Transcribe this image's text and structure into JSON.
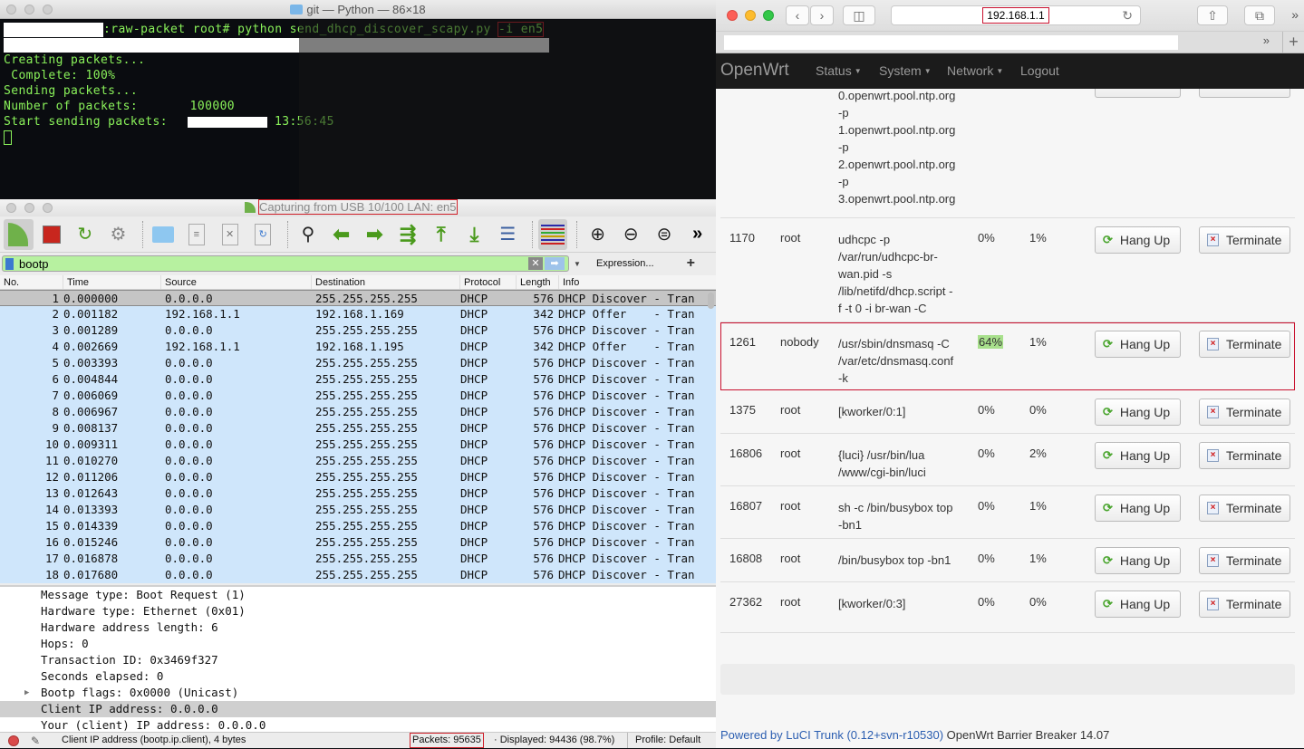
{
  "terminal": {
    "title": "git — Python — 86×18",
    "prompt_suffix": ":raw-packet root# python send_dhcp_discover_scapy.py ",
    "command_args": "-i en5",
    "lines": [
      "Creating packets...",
      " Complete: 100%",
      "Sending packets...",
      "Number of packets:       100000"
    ],
    "start_label": "Start sending packets:",
    "start_time": "13:56:45"
  },
  "wireshark": {
    "title": "Capturing from USB 10/100 LAN: en5",
    "toolbar": {
      "icons": [
        "start-capture-icon",
        "stop-capture-icon",
        "restart-capture-icon",
        "capture-options-icon",
        "open-file-icon",
        "save-file-icon",
        "close-file-icon",
        "reload-file-icon",
        "find-packet-icon",
        "go-back-icon",
        "go-forward-icon",
        "go-to-packet-icon",
        "go-first-icon",
        "go-last-icon",
        "autoscroll-icon",
        "colorize-icon",
        "zoom-in-icon",
        "zoom-out-icon",
        "zoom-normal-icon",
        "more-icon"
      ],
      "more_label": "»"
    },
    "filter": {
      "value": "bootp",
      "expression_label": "Expression...",
      "add_label": "+"
    },
    "columns": [
      "No.",
      "Time",
      "Source",
      "Destination",
      "Protocol",
      "Length",
      "Info"
    ],
    "packets": [
      {
        "no": "1",
        "time": "0.000000",
        "src": "0.0.0.0",
        "dst": "255.255.255.255",
        "proto": "DHCP",
        "len": "576",
        "info": "DHCP Discover - Tran"
      },
      {
        "no": "2",
        "time": "0.001182",
        "src": "192.168.1.1",
        "dst": "192.168.1.169",
        "proto": "DHCP",
        "len": "342",
        "info": "DHCP Offer    - Tran"
      },
      {
        "no": "3",
        "time": "0.001289",
        "src": "0.0.0.0",
        "dst": "255.255.255.255",
        "proto": "DHCP",
        "len": "576",
        "info": "DHCP Discover - Tran"
      },
      {
        "no": "4",
        "time": "0.002669",
        "src": "192.168.1.1",
        "dst": "192.168.1.195",
        "proto": "DHCP",
        "len": "342",
        "info": "DHCP Offer    - Tran"
      },
      {
        "no": "5",
        "time": "0.003393",
        "src": "0.0.0.0",
        "dst": "255.255.255.255",
        "proto": "DHCP",
        "len": "576",
        "info": "DHCP Discover - Tran"
      },
      {
        "no": "6",
        "time": "0.004844",
        "src": "0.0.0.0",
        "dst": "255.255.255.255",
        "proto": "DHCP",
        "len": "576",
        "info": "DHCP Discover - Tran"
      },
      {
        "no": "7",
        "time": "0.006069",
        "src": "0.0.0.0",
        "dst": "255.255.255.255",
        "proto": "DHCP",
        "len": "576",
        "info": "DHCP Discover - Tran"
      },
      {
        "no": "8",
        "time": "0.006967",
        "src": "0.0.0.0",
        "dst": "255.255.255.255",
        "proto": "DHCP",
        "len": "576",
        "info": "DHCP Discover - Tran"
      },
      {
        "no": "9",
        "time": "0.008137",
        "src": "0.0.0.0",
        "dst": "255.255.255.255",
        "proto": "DHCP",
        "len": "576",
        "info": "DHCP Discover - Tran"
      },
      {
        "no": "10",
        "time": "0.009311",
        "src": "0.0.0.0",
        "dst": "255.255.255.255",
        "proto": "DHCP",
        "len": "576",
        "info": "DHCP Discover - Tran"
      },
      {
        "no": "11",
        "time": "0.010270",
        "src": "0.0.0.0",
        "dst": "255.255.255.255",
        "proto": "DHCP",
        "len": "576",
        "info": "DHCP Discover - Tran"
      },
      {
        "no": "12",
        "time": "0.011206",
        "src": "0.0.0.0",
        "dst": "255.255.255.255",
        "proto": "DHCP",
        "len": "576",
        "info": "DHCP Discover - Tran"
      },
      {
        "no": "13",
        "time": "0.012643",
        "src": "0.0.0.0",
        "dst": "255.255.255.255",
        "proto": "DHCP",
        "len": "576",
        "info": "DHCP Discover - Tran"
      },
      {
        "no": "14",
        "time": "0.013393",
        "src": "0.0.0.0",
        "dst": "255.255.255.255",
        "proto": "DHCP",
        "len": "576",
        "info": "DHCP Discover - Tran"
      },
      {
        "no": "15",
        "time": "0.014339",
        "src": "0.0.0.0",
        "dst": "255.255.255.255",
        "proto": "DHCP",
        "len": "576",
        "info": "DHCP Discover - Tran"
      },
      {
        "no": "16",
        "time": "0.015246",
        "src": "0.0.0.0",
        "dst": "255.255.255.255",
        "proto": "DHCP",
        "len": "576",
        "info": "DHCP Discover - Tran"
      },
      {
        "no": "17",
        "time": "0.016878",
        "src": "0.0.0.0",
        "dst": "255.255.255.255",
        "proto": "DHCP",
        "len": "576",
        "info": "DHCP Discover - Tran"
      },
      {
        "no": "18",
        "time": "0.017680",
        "src": "0.0.0.0",
        "dst": "255.255.255.255",
        "proto": "DHCP",
        "len": "576",
        "info": "DHCP Discover - Tran"
      }
    ],
    "details": [
      {
        "text": "Message type: Boot Request (1)"
      },
      {
        "text": "Hardware type: Ethernet (0x01)"
      },
      {
        "text": "Hardware address length: 6"
      },
      {
        "text": "Hops: 0"
      },
      {
        "text": "Transaction ID: 0x3469f327"
      },
      {
        "text": "Seconds elapsed: 0"
      },
      {
        "text": "Bootp flags: 0x0000 (Unicast)",
        "expandable": true
      },
      {
        "text": "Client IP address: 0.0.0.0",
        "selected": true
      },
      {
        "text": "Your (client) IP address: 0.0.0.0"
      }
    ],
    "status": {
      "field_info": "Client IP address (bootp.ip.client), 4 bytes",
      "packets": "Packets: 95635",
      "displayed": "· Displayed: 94436 (98.7%)",
      "profile": "Profile: Default"
    }
  },
  "browser": {
    "url": "192.168.1.1",
    "favorites_more": "»",
    "new_tab": "+",
    "nav": {
      "brand": "OpenWrt",
      "items": [
        "Status",
        "System",
        "Network",
        "Logout"
      ]
    },
    "processes": [
      {
        "pid": "",
        "owner": "",
        "cmd": "0.openwrt.pool.ntp.org\n-p\n1.openwrt.pool.ntp.org\n-p\n2.openwrt.pool.ntp.org\n-p\n3.openwrt.pool.ntp.org",
        "cpu": "",
        "mem": "",
        "partial": true
      },
      {
        "pid": "1170",
        "owner": "root",
        "cmd": "udhcpc -p\n/var/run/udhcpc-br-\nwan.pid -s\n/lib/netifd/dhcp.script -\nf -t 0 -i br-wan -C",
        "cpu": "0%",
        "mem": "1%"
      },
      {
        "pid": "1261",
        "owner": "nobody",
        "cmd": "/usr/sbin/dnsmasq -C\n/var/etc/dnsmasq.conf\n-k",
        "cpu": "64%",
        "mem": "1%",
        "highlight": true
      },
      {
        "pid": "1375",
        "owner": "root",
        "cmd": "[kworker/0:1]",
        "cpu": "0%",
        "mem": "0%"
      },
      {
        "pid": "16806",
        "owner": "root",
        "cmd": "{luci} /usr/bin/lua\n/www/cgi-bin/luci",
        "cpu": "0%",
        "mem": "2%"
      },
      {
        "pid": "16807",
        "owner": "root",
        "cmd": "sh -c /bin/busybox top\n-bn1",
        "cpu": "0%",
        "mem": "1%"
      },
      {
        "pid": "16808",
        "owner": "root",
        "cmd": "/bin/busybox top -bn1",
        "cpu": "0%",
        "mem": "1%"
      },
      {
        "pid": "27362",
        "owner": "root",
        "cmd": "[kworker/0:3]",
        "cpu": "0%",
        "mem": "0%"
      }
    ],
    "hang_up_label": "Hang Up",
    "terminate_label": "Terminate",
    "footer_link": "Powered by LuCI Trunk (0.12+svn-r10530)",
    "footer_text": " OpenWrt Barrier Breaker 14.07",
    "highlight_color": "#a8e08c"
  }
}
